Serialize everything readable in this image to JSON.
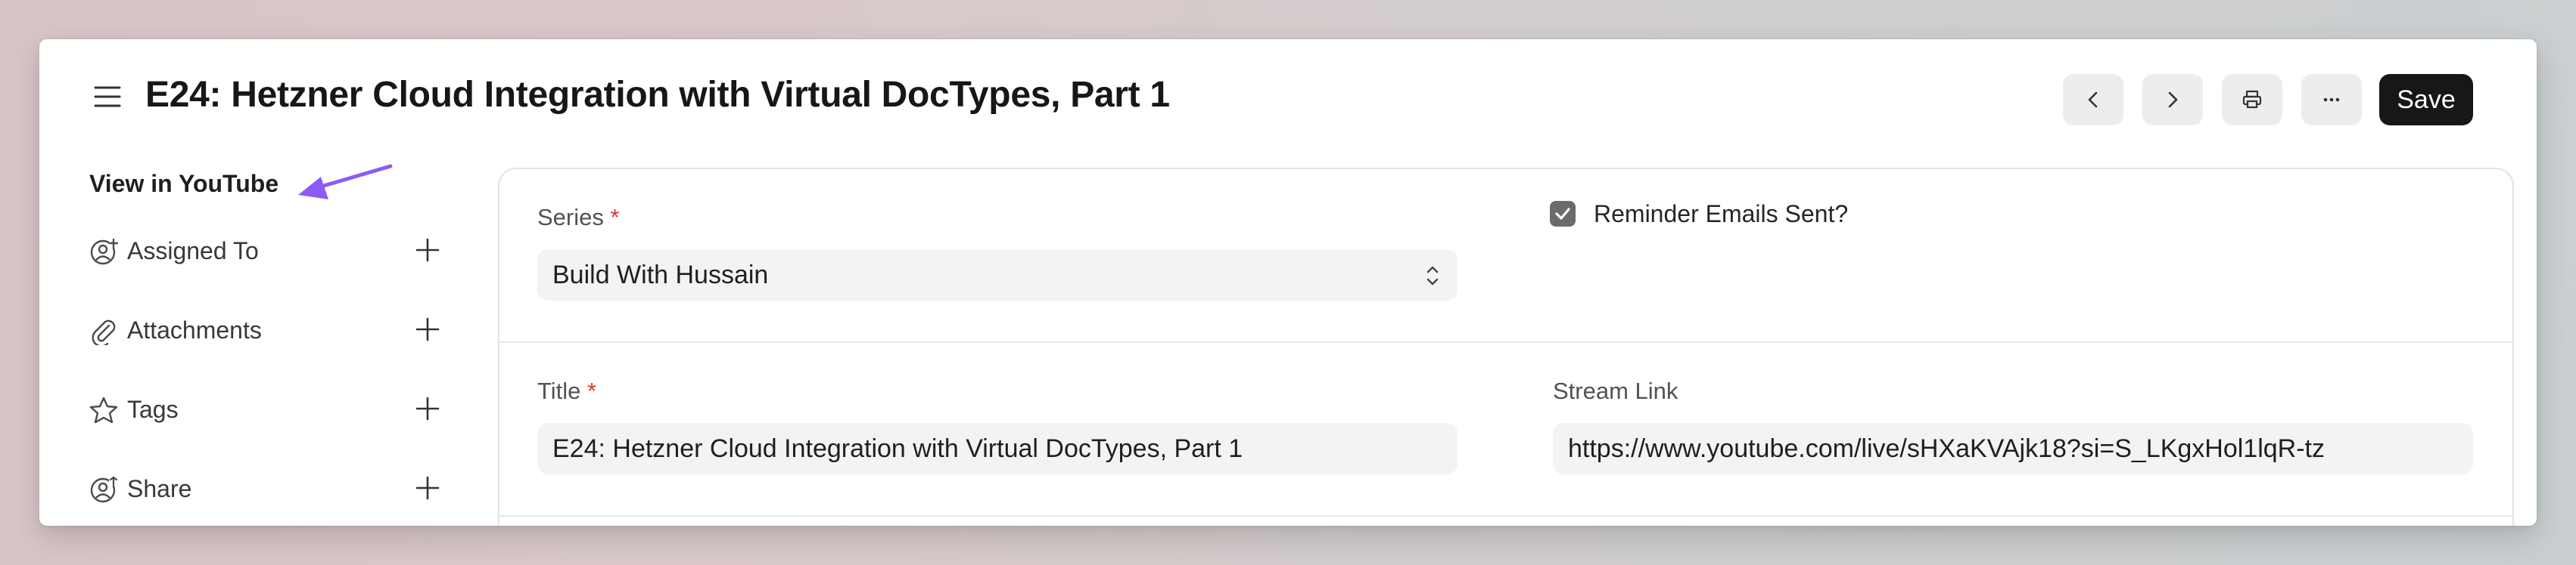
{
  "header": {
    "title": "E24: Hetzner Cloud Integration with Virtual DocTypes, Part 1",
    "save_label": "Save"
  },
  "sidebar": {
    "youtube_link": "View in YouTube",
    "items": [
      {
        "label": "Assigned To",
        "icon": "add-user-icon"
      },
      {
        "label": "Attachments",
        "icon": "paperclip-icon"
      },
      {
        "label": "Tags",
        "icon": "star-icon"
      },
      {
        "label": "Share",
        "icon": "share-user-icon"
      }
    ]
  },
  "form": {
    "series": {
      "label": "Series",
      "value": "Build With Hussain",
      "required": "*"
    },
    "reminder": {
      "label": "Reminder Emails Sent?",
      "checked": true
    },
    "title": {
      "label": "Title",
      "value": "E24: Hetzner Cloud Integration with Virtual DocTypes, Part 1",
      "required": "*"
    },
    "stream_link": {
      "label": "Stream Link",
      "value": "https://www.youtube.com/live/sHXaKVAjk18?si=S_LKgxHol1lqR-tz"
    }
  },
  "colors": {
    "accent_arrow": "#8b5cf6",
    "save_button": "#171717",
    "required": "#e03636",
    "checkbox": "#6b6b6b"
  }
}
